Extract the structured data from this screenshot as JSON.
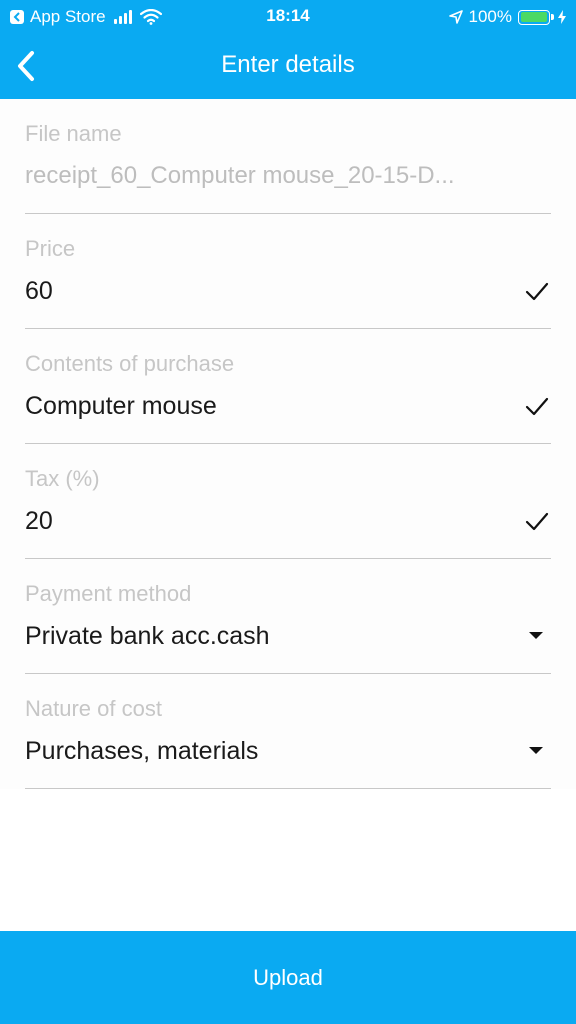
{
  "status_bar": {
    "carrier": "App Store",
    "time": "18:14",
    "battery": "100%",
    "battery_level": 1.0
  },
  "nav": {
    "title": "Enter details",
    "back_icon": "chevron-left-icon"
  },
  "fields": [
    {
      "label": "File name",
      "value": "receipt_60_Computer mouse_20-15-D...",
      "indicator": "none"
    },
    {
      "label": "Price",
      "value": "60",
      "indicator": "check-icon"
    },
    {
      "label": "Contents of purchase",
      "value": "Computer mouse",
      "indicator": "check-icon"
    },
    {
      "label": "Tax (%)",
      "value": "20",
      "indicator": "check-icon"
    },
    {
      "label": "Payment method",
      "value": "Private bank acc.cash",
      "indicator": "dropdown-icon"
    },
    {
      "label": "Nature of cost",
      "value": "Purchases, materials",
      "indicator": "dropdown-icon"
    }
  ],
  "upload_label": "Upload",
  "colors": {
    "accent": "#0aaaf2",
    "label": "#c6c6c6",
    "value": "#1a1a1a",
    "divider": "#c8c8c8",
    "battery": "#4cd964"
  }
}
